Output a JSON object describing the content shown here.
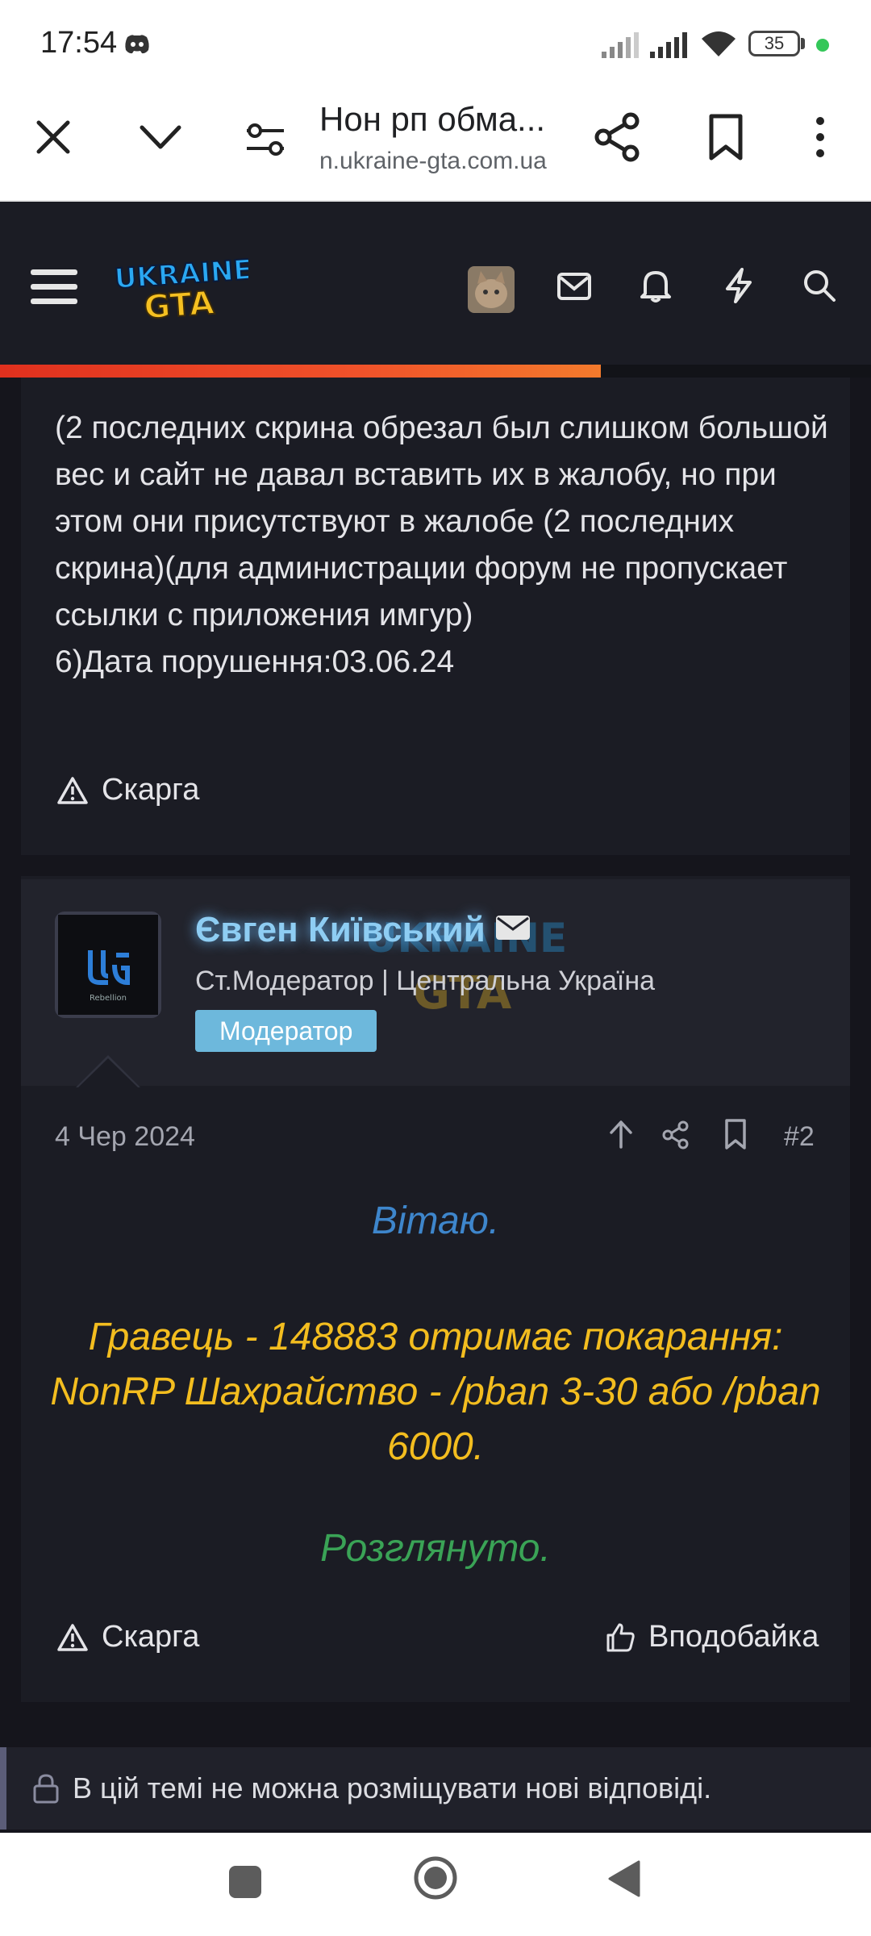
{
  "status_bar": {
    "time": "17:54",
    "battery": "35"
  },
  "browser": {
    "title": "Нон рп обма...",
    "url": "n.ukraine-gta.com.ua"
  },
  "site": {
    "logo_line1": "UKRAINE",
    "logo_line2": "GTA",
    "reading_progress": 0.69,
    "brand_colors": {
      "header": "#1b1c24",
      "progress": "#f0522a"
    }
  },
  "post1": {
    "text": "(2 последних скрина обрезал был слишком большой вес и сайт не давал вставить их в жалобу, но при этом они присутствуют в жалобе (2 последних скрина)(для администрации форум не пропускает ссылки с приложения имгур)\n6)Дата порушення:03.06.24",
    "report_label": "Скарга"
  },
  "post2": {
    "author_name": "Євген Київський",
    "author_title": "Ст.Модератор | Центральна Україна",
    "author_badge": "Модератор",
    "avatar_caption": "Rebellion",
    "date": "4 Чер 2024",
    "post_number": "#2",
    "greeting": "Вітаю.",
    "verdict": "Гравець - 148883 отримає покарання: NonRP Шахрайство - /pban 3-30 або /pban 6000.",
    "reviewed": "Розглянуто.",
    "report_label": "Скарга",
    "like_label": "Вподобайка",
    "colors": {
      "greeting": "#3e86cc",
      "verdict": "#f3bd1f",
      "reviewed": "#3aa356"
    }
  },
  "thread": {
    "locked_text": "В цій темі не можна розміщувати нові відповіді."
  }
}
